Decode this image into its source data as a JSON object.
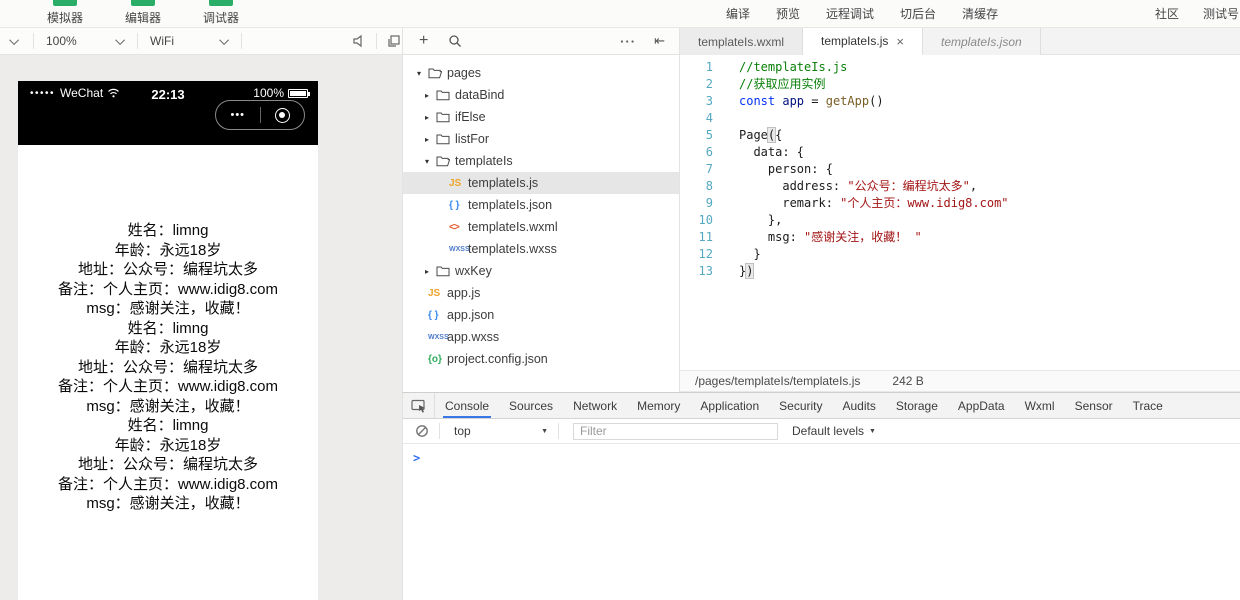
{
  "topbar": {
    "view_buttons": [
      "模拟器",
      "编辑器",
      "调试器"
    ],
    "action_buttons": [
      "编译",
      "预览",
      "远程调试",
      "切后台",
      "清缓存"
    ],
    "right_buttons": [
      "社区",
      "测试号"
    ]
  },
  "toolbar": {
    "zoom_value": "100%",
    "network_value": "WiFi"
  },
  "file_header": {
    "more_label": "···"
  },
  "simulator": {
    "status": {
      "signal_dots": "•••••",
      "carrier": "WeChat",
      "time": "22:13",
      "battery_percent": "100%"
    },
    "capsule": {
      "more": "•••"
    },
    "content_blocks": [
      [
        "姓名：limng",
        "年龄：永远18岁",
        "地址：公众号：编程坑太多",
        "备注：个人主页：www.idig8.com",
        "msg：感谢关注，收藏！"
      ],
      [
        "姓名：limng",
        "年龄：永远18岁",
        "地址：公众号：编程坑太多",
        "备注：个人主页：www.idig8.com",
        "msg：感谢关注，收藏！"
      ],
      [
        "姓名：limng",
        "年龄：永远18岁",
        "地址：公众号：编程坑太多",
        "备注：个人主页：www.idig8.com",
        "msg：感谢关注，收藏！"
      ]
    ]
  },
  "file_panel": {
    "tree": [
      {
        "label": "pages",
        "level": 0,
        "caret": "open",
        "icon": "folder-open",
        "selected": false
      },
      {
        "label": "dataBind",
        "level": 1,
        "caret": "closed",
        "icon": "folder",
        "selected": false
      },
      {
        "label": "ifElse",
        "level": 1,
        "caret": "closed",
        "icon": "folder",
        "selected": false
      },
      {
        "label": "listFor",
        "level": 1,
        "caret": "closed",
        "icon": "folder",
        "selected": false
      },
      {
        "label": "templateIs",
        "level": 1,
        "caret": "open",
        "icon": "folder-open",
        "selected": false
      },
      {
        "label": "templateIs.js",
        "level": 2,
        "caret": "",
        "icon": "js",
        "selected": true
      },
      {
        "label": "templateIs.json",
        "level": 2,
        "caret": "",
        "icon": "json",
        "selected": false
      },
      {
        "label": "templateIs.wxml",
        "level": 2,
        "caret": "",
        "icon": "wxml",
        "selected": false
      },
      {
        "label": "templateIs.wxss",
        "level": 2,
        "caret": "",
        "icon": "wxss",
        "selected": false
      },
      {
        "label": "wxKey",
        "level": 1,
        "caret": "closed",
        "icon": "folder",
        "selected": false
      },
      {
        "label": "app.js",
        "level": 0,
        "caret": "",
        "icon": "js",
        "selected": false
      },
      {
        "label": "app.json",
        "level": 0,
        "caret": "",
        "icon": "json",
        "selected": false
      },
      {
        "label": "app.wxss",
        "level": 0,
        "caret": "",
        "icon": "wxss",
        "selected": false
      },
      {
        "label": "project.config.json",
        "level": 0,
        "caret": "",
        "icon": "config",
        "selected": false
      }
    ]
  },
  "editor": {
    "tabs": [
      {
        "label": "templateIs.wxml",
        "state": "inactive",
        "closable": false
      },
      {
        "label": "templateIs.js",
        "state": "active",
        "closable": true
      },
      {
        "label": "templateIs.json",
        "state": "preview",
        "closable": false
      }
    ],
    "close_label": "×",
    "code_lines": [
      {
        "n": 1,
        "tokens": [
          [
            "comment",
            "//templateIs.js"
          ]
        ]
      },
      {
        "n": 2,
        "tokens": [
          [
            "comment",
            "//获取应用实例"
          ]
        ]
      },
      {
        "n": 3,
        "tokens": [
          [
            "kw",
            "const"
          ],
          [
            "plain",
            " "
          ],
          [
            "var",
            "app"
          ],
          [
            "plain",
            " = "
          ],
          [
            "fn",
            "getApp"
          ],
          [
            "plain",
            "()"
          ]
        ]
      },
      {
        "n": 4,
        "tokens": []
      },
      {
        "n": 5,
        "tokens": [
          [
            "plain",
            "Page"
          ],
          [
            "hl",
            "("
          ],
          [
            "plain",
            "{"
          ]
        ]
      },
      {
        "n": 6,
        "tokens": [
          [
            "plain",
            "  data: {"
          ]
        ]
      },
      {
        "n": 7,
        "tokens": [
          [
            "plain",
            "    person: {"
          ]
        ]
      },
      {
        "n": 8,
        "tokens": [
          [
            "plain",
            "      address: "
          ],
          [
            "str",
            "\"公众号：编程坑太多\""
          ],
          [
            "plain",
            ","
          ]
        ]
      },
      {
        "n": 9,
        "tokens": [
          [
            "plain",
            "      remark: "
          ],
          [
            "str",
            "\"个人主页：www.idig8.com\""
          ]
        ]
      },
      {
        "n": 10,
        "tokens": [
          [
            "plain",
            "    },"
          ]
        ]
      },
      {
        "n": 11,
        "tokens": [
          [
            "plain",
            "    msg: "
          ],
          [
            "str",
            "\"感谢关注，收藏！ \""
          ]
        ]
      },
      {
        "n": 12,
        "tokens": [
          [
            "plain",
            "  }"
          ]
        ]
      },
      {
        "n": 13,
        "tokens": [
          [
            "plain",
            "}"
          ],
          [
            "hl",
            ")"
          ]
        ]
      }
    ],
    "statusbar": {
      "path": "/pages/templateIs/templateIs.js",
      "size": "242 B"
    }
  },
  "devtools": {
    "tabs": [
      "Console",
      "Sources",
      "Network",
      "Memory",
      "Application",
      "Security",
      "Audits",
      "Storage",
      "AppData",
      "Wxml",
      "Sensor",
      "Trace"
    ],
    "active_tab": "Console",
    "context_value": "top",
    "filter_placeholder": "Filter",
    "levels_label": "Default levels",
    "prompt": ">"
  },
  "colors": {
    "wechat_green": "#2aae67",
    "devtools_accent_blue": "#3b78e7",
    "code_string_red": "#a31515",
    "code_comment_green": "#0a8008",
    "code_keyword_blue": "#0433fa"
  }
}
